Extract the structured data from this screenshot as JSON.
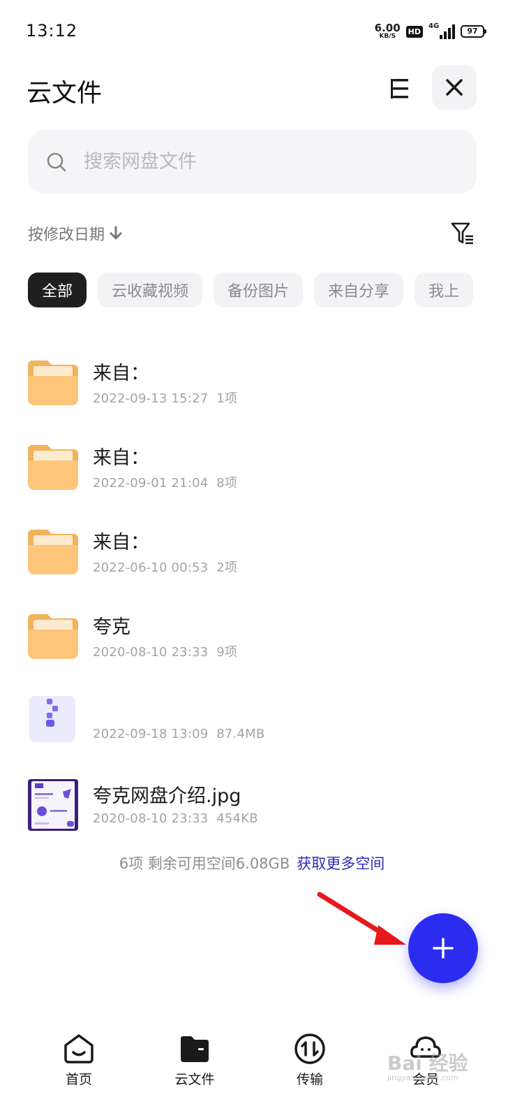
{
  "status_bar": {
    "time": "13:12",
    "net_speed": "6.00",
    "net_unit": "KB/S",
    "hd": "HD",
    "network": "4G",
    "battery": "97"
  },
  "header": {
    "title": "云文件",
    "menu_icon": "list-icon",
    "close_icon": "close-icon"
  },
  "search": {
    "placeholder": "搜索网盘文件",
    "value": ""
  },
  "sort": {
    "label": "按修改日期"
  },
  "chips": [
    "全部",
    "云收藏视频",
    "备份图片",
    "来自分享",
    "我上"
  ],
  "files": [
    {
      "name": "来自：",
      "date": "2022-09-13 15:27",
      "size": "1项",
      "type": "folder"
    },
    {
      "name": "来自：",
      "date": "2022-09-01 21:04",
      "size": "8项",
      "type": "folder"
    },
    {
      "name": "来自：",
      "date": "2022-06-10 00:53",
      "size": "2项",
      "type": "folder"
    },
    {
      "name": "夸克",
      "date": "2020-08-10 23:33",
      "size": "9项",
      "type": "folder"
    },
    {
      "name": "",
      "date": "2022-09-18 13:09",
      "size": "87.4MB",
      "type": "archive"
    },
    {
      "name": "夸克网盘介绍.jpg",
      "date": "2020-08-10 23:33",
      "size": "454KB",
      "type": "image"
    }
  ],
  "summary": {
    "text": "6项 剩余可用空间6.08GB",
    "link": "获取更多空间"
  },
  "nav": [
    {
      "label": "首页",
      "icon": "home-icon"
    },
    {
      "label": "云文件",
      "icon": "folder-icon"
    },
    {
      "label": "传输",
      "icon": "transfer-icon"
    },
    {
      "label": "会员",
      "icon": "member-icon"
    }
  ],
  "watermark": "Bai 经验",
  "watermark_sub": "jingyan.baidu.com",
  "colors": {
    "accent": "#2c2cf0",
    "folder": "#fdc67a",
    "link": "#2b2bb5",
    "arrow": "#e8191c"
  }
}
